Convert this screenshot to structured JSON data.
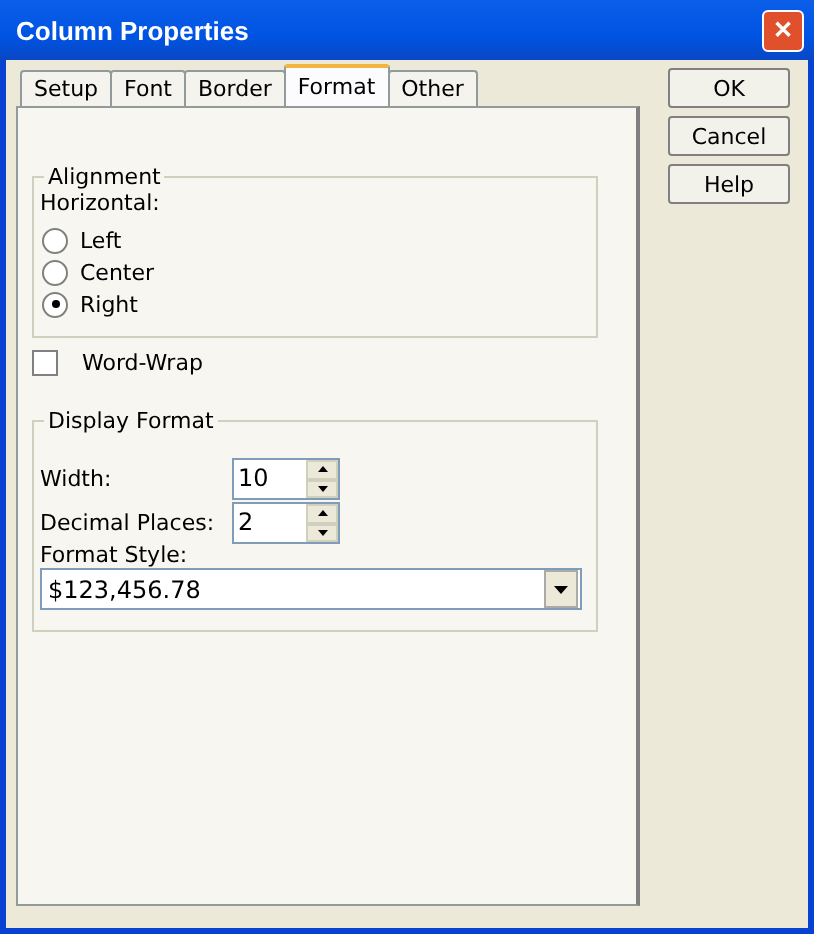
{
  "window": {
    "title": "Column Properties",
    "close": "✕"
  },
  "tabs": [
    {
      "label": "Setup",
      "selected": false
    },
    {
      "label": "Font",
      "selected": false
    },
    {
      "label": "Border",
      "selected": false
    },
    {
      "label": "Format",
      "selected": true
    },
    {
      "label": "Other",
      "selected": false
    }
  ],
  "alignment": {
    "title": "Alignment",
    "label": "Horizontal:",
    "options": [
      {
        "label": "Left",
        "selected": false
      },
      {
        "label": "Center",
        "selected": false
      },
      {
        "label": "Right",
        "selected": true
      }
    ]
  },
  "word_wrap": {
    "label": "Word-Wrap",
    "checked": false
  },
  "display_format": {
    "title": "Display Format",
    "width": {
      "label": "Width:",
      "value": "10"
    },
    "decimal_places": {
      "label": "Decimal Places:",
      "value": "2"
    },
    "format_style": {
      "label": "Format Style:",
      "value": "$123,456.78"
    }
  },
  "buttons": [
    "OK",
    "Cancel",
    "Help"
  ]
}
